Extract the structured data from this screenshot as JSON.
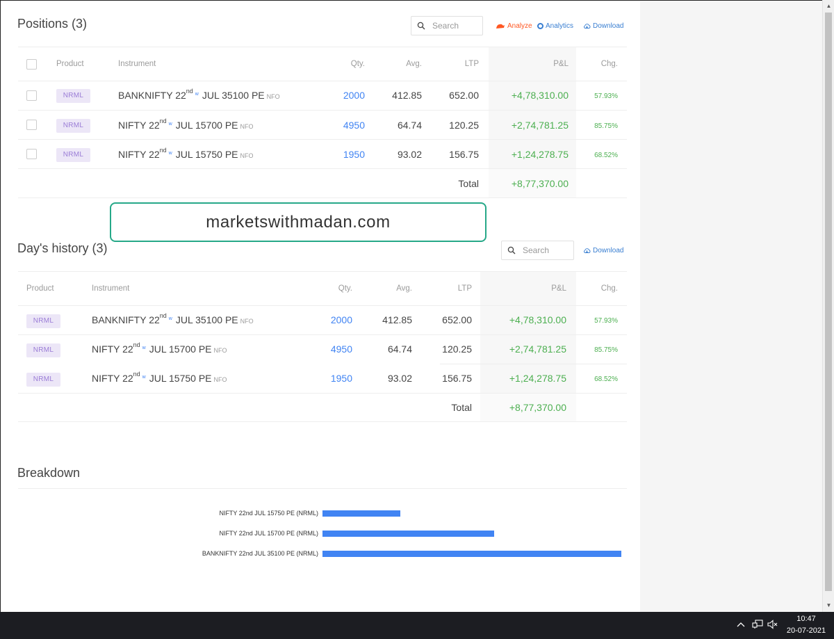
{
  "positions": {
    "title": "Positions (3)",
    "search_placeholder": "Search",
    "links": {
      "analyze": "Analyze",
      "analytics": "Analytics",
      "download": "Download"
    },
    "columns": {
      "product": "Product",
      "instrument": "Instrument",
      "qty": "Qty.",
      "avg": "Avg.",
      "ltp": "LTP",
      "pnl": "P&L",
      "chg": "Chg."
    },
    "rows": [
      {
        "product": "NRML",
        "name": "BANKNIFTY 22",
        "ord": "nd",
        "week": "w",
        "rest": "JUL 35100 PE",
        "exchange": "NFO",
        "qty": "2000",
        "avg": "412.85",
        "ltp": "652.00",
        "pnl": "+4,78,310.00",
        "chg": "57.93%"
      },
      {
        "product": "NRML",
        "name": "NIFTY 22",
        "ord": "nd",
        "week": "w",
        "rest": "JUL 15700 PE",
        "exchange": "NFO",
        "qty": "4950",
        "avg": "64.74",
        "ltp": "120.25",
        "pnl": "+2,74,781.25",
        "chg": "85.75%"
      },
      {
        "product": "NRML",
        "name": "NIFTY 22",
        "ord": "nd",
        "week": "w",
        "rest": "JUL 15750 PE",
        "exchange": "NFO",
        "qty": "1950",
        "avg": "93.02",
        "ltp": "156.75",
        "pnl": "+1,24,278.75",
        "chg": "68.52%"
      }
    ],
    "total_label": "Total",
    "total_value": "+8,77,370.00"
  },
  "watermark": "marketswithmadan.com",
  "history": {
    "title": "Day's history (3)",
    "search_placeholder": "Search",
    "download": "Download",
    "columns": {
      "product": "Product",
      "instrument": "Instrument",
      "qty": "Qty.",
      "avg": "Avg.",
      "ltp": "LTP",
      "pnl": "P&L",
      "chg": "Chg."
    },
    "rows": [
      {
        "product": "NRML",
        "name": "BANKNIFTY 22",
        "ord": "nd",
        "week": "w",
        "rest": "JUL 35100 PE",
        "exchange": "NFO",
        "qty": "2000",
        "avg": "412.85",
        "ltp": "652.00",
        "pnl": "+4,78,310.00",
        "chg": "57.93%"
      },
      {
        "product": "NRML",
        "name": "NIFTY 22",
        "ord": "nd",
        "week": "w",
        "rest": "JUL 15700 PE",
        "exchange": "NFO",
        "qty": "4950",
        "avg": "64.74",
        "ltp": "120.25",
        "pnl": "+2,74,781.25",
        "chg": "85.75%"
      },
      {
        "product": "NRML",
        "name": "NIFTY 22",
        "ord": "nd",
        "week": "w",
        "rest": "JUL 15750 PE",
        "exchange": "NFO",
        "qty": "1950",
        "avg": "93.02",
        "ltp": "156.75",
        "pnl": "+1,24,278.75",
        "chg": "68.52%"
      }
    ],
    "total_label": "Total",
    "total_value": "+8,77,370.00"
  },
  "breakdown": {
    "title": "Breakdown",
    "chart_data": {
      "type": "bar",
      "orientation": "horizontal",
      "categories": [
        "NIFTY 22nd JUL 15750 PE (NRML)",
        "NIFTY 22nd JUL 15700 PE (NRML)",
        "BANKNIFTY 22nd JUL 35100 PE (NRML)"
      ],
      "values": [
        124278.75,
        274781.25,
        478310.0
      ],
      "color": "#4184f3"
    }
  },
  "taskbar": {
    "time": "10:47",
    "date": "20-07-2021",
    "icons": [
      "chevron-up-icon",
      "network-icon",
      "volume-muted-icon"
    ]
  },
  "colors": {
    "accent": "#4184f3",
    "profit": "#4caf50",
    "analyze": "#ff5722",
    "badge_bg": "#ece6f7",
    "badge_text": "#9a7cd6",
    "watermark_border": "#26a888"
  }
}
